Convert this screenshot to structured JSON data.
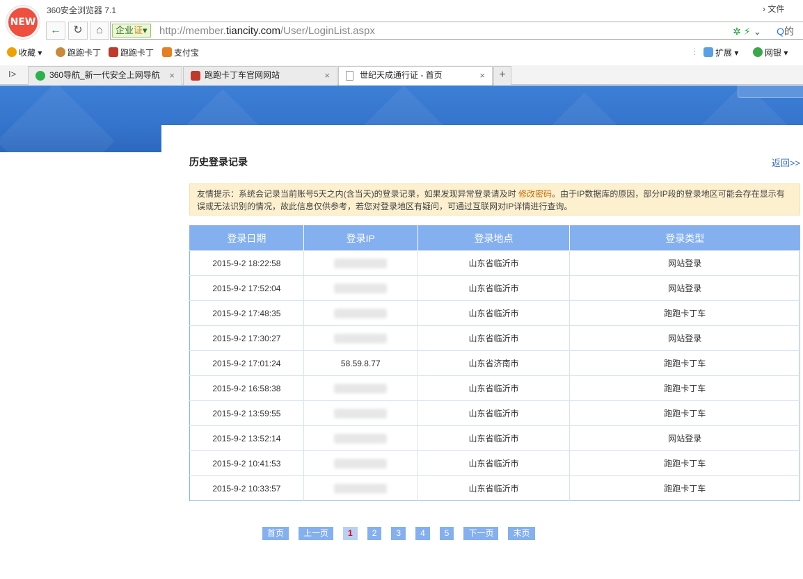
{
  "browser": {
    "logo_text": "NEW",
    "app_title": "360安全浏览器 7.1",
    "file_menu": "文件",
    "cert_label": "企业",
    "cert_badge": "证",
    "url_prefix": "http://member.",
    "url_domain": "tiancity.com",
    "url_path": "/User/LoginList.aspx",
    "search_hint": "的",
    "bookmarks": [
      {
        "label": "收藏",
        "icon": "star-icon",
        "color": "#f0a000"
      },
      {
        "label": "跑跑卡丁",
        "icon": "monkey-icon",
        "color": "#c98a3a"
      },
      {
        "label": "跑跑卡丁",
        "icon": "kart-icon",
        "color": "#c0392b"
      },
      {
        "label": "支付宝",
        "icon": "alipay-icon",
        "color": "#e67e22"
      }
    ],
    "ext_label": "扩展",
    "bank_label": "网银",
    "tabs": [
      {
        "title": "360导航_新一代安全上网导航",
        "icon_color": "#2bb24c"
      },
      {
        "title": "跑跑卡丁车官网网站",
        "icon_color": "#c0392b"
      },
      {
        "title": "世纪天成通行证 - 首页",
        "icon_color": "#cccccc"
      }
    ],
    "tab_close": "×",
    "new_tab": "+"
  },
  "page": {
    "section_title": "历史登录记录",
    "back_link": "返回>>",
    "notice_before": "友情提示：系统会记录当前账号5天之内(含当天)的登录记录，如果发现异常登录请及时 ",
    "notice_link": "修改密码",
    "notice_after": "。由于IP数据库的原因，部分IP段的登录地区可能会存在显示有误或无法识别的情况，故此信息仅供参考，若您对登录地区有疑问，可通过互联网对IP详情进行查询。",
    "columns": [
      "登录日期",
      "登录IP",
      "登录地点",
      "登录类型"
    ],
    "rows": [
      {
        "date": "2015-9-2 18:22:58",
        "ip": "",
        "location": "山东省临沂市",
        "type": "网站登录"
      },
      {
        "date": "2015-9-2 17:52:04",
        "ip": "",
        "location": "山东省临沂市",
        "type": "网站登录"
      },
      {
        "date": "2015-9-2 17:48:35",
        "ip": "",
        "location": "山东省临沂市",
        "type": "跑跑卡丁车"
      },
      {
        "date": "2015-9-2 17:30:27",
        "ip": "",
        "location": "山东省临沂市",
        "type": "网站登录"
      },
      {
        "date": "2015-9-2 17:01:24",
        "ip": "58.59.8.77",
        "location": "山东省济南市",
        "type": "跑跑卡丁车"
      },
      {
        "date": "2015-9-2 16:58:38",
        "ip": "",
        "location": "山东省临沂市",
        "type": "跑跑卡丁车"
      },
      {
        "date": "2015-9-2 13:59:55",
        "ip": "",
        "location": "山东省临沂市",
        "type": "跑跑卡丁车"
      },
      {
        "date": "2015-9-2 13:52:14",
        "ip": "",
        "location": "山东省临沂市",
        "type": "网站登录"
      },
      {
        "date": "2015-9-2 10:41:53",
        "ip": "",
        "location": "山东省临沂市",
        "type": "跑跑卡丁车"
      },
      {
        "date": "2015-9-2 10:33:57",
        "ip": "",
        "location": "山东省临沂市",
        "type": "跑跑卡丁车"
      }
    ],
    "pager": [
      {
        "label": "首页",
        "current": false
      },
      {
        "label": "上一页",
        "current": false
      },
      {
        "label": "1",
        "current": true
      },
      {
        "label": "2",
        "current": false
      },
      {
        "label": "3",
        "current": false
      },
      {
        "label": "4",
        "current": false
      },
      {
        "label": "5",
        "current": false
      },
      {
        "label": "下一页",
        "current": false
      },
      {
        "label": "末页",
        "current": false
      }
    ]
  }
}
